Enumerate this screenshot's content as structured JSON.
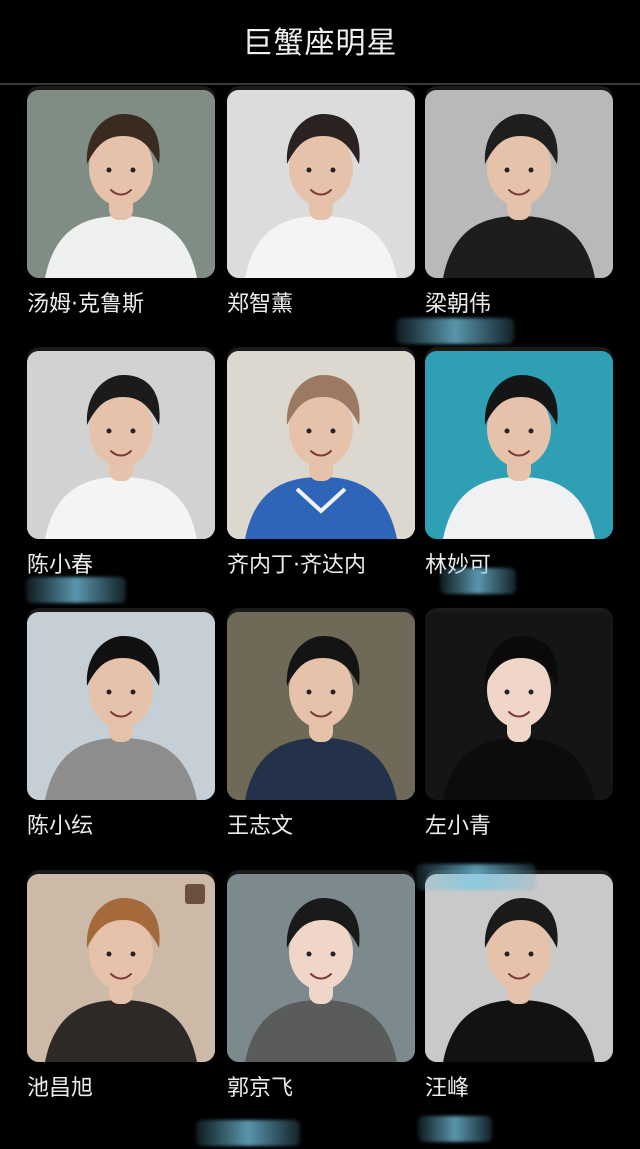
{
  "header": {
    "title": "巨蟹座明星"
  },
  "celebrities": [
    {
      "name": "汤姆·克鲁斯",
      "photo_bg": "#7f8d84",
      "shirt": "#f2f2f2",
      "hair": "#3a2a20"
    },
    {
      "name": "郑智薰",
      "photo_bg": "#dcdcdc",
      "shirt": "#f4f4f4",
      "hair": "#2a2220"
    },
    {
      "name": "梁朝伟",
      "photo_bg": "#b9b9b9",
      "shirt": "#1a1a1a",
      "hair": "#1e1e1e"
    },
    {
      "name": "陈小春",
      "photo_bg": "#d2d2d2",
      "shirt": "#f5f5f5",
      "hair": "#1b1b1b"
    },
    {
      "name": "齐内丁·齐达内",
      "photo_bg": "#ddd8cf",
      "shirt": "#2a62b8",
      "hair": "#9c7a62"
    },
    {
      "name": "林妙可",
      "photo_bg": "#2f9fb4",
      "shirt": "#f3f3f3",
      "hair": "#151515"
    },
    {
      "name": "陈小纭",
      "photo_bg": "#c6cfd6",
      "shirt": "#8c8c8c",
      "hair": "#111111"
    },
    {
      "name": "王志文",
      "photo_bg": "#6f6a58",
      "shirt": "#22304a",
      "hair": "#141414"
    },
    {
      "name": "左小青",
      "photo_bg": "#151515",
      "shirt": "#0c0c0c",
      "hair": "#0a0a0a"
    },
    {
      "name": "池昌旭",
      "photo_bg": "#cdb9a8",
      "shirt": "#2a2624",
      "hair": "#a56a3c"
    },
    {
      "name": "郭京飞",
      "photo_bg": "#7c8a8e",
      "shirt": "#5a5a5a",
      "hair": "#1a1a1a"
    },
    {
      "name": "汪峰",
      "photo_bg": "#c9c9c9",
      "shirt": "#0e0e0e",
      "hair": "#1a1a1a"
    }
  ]
}
